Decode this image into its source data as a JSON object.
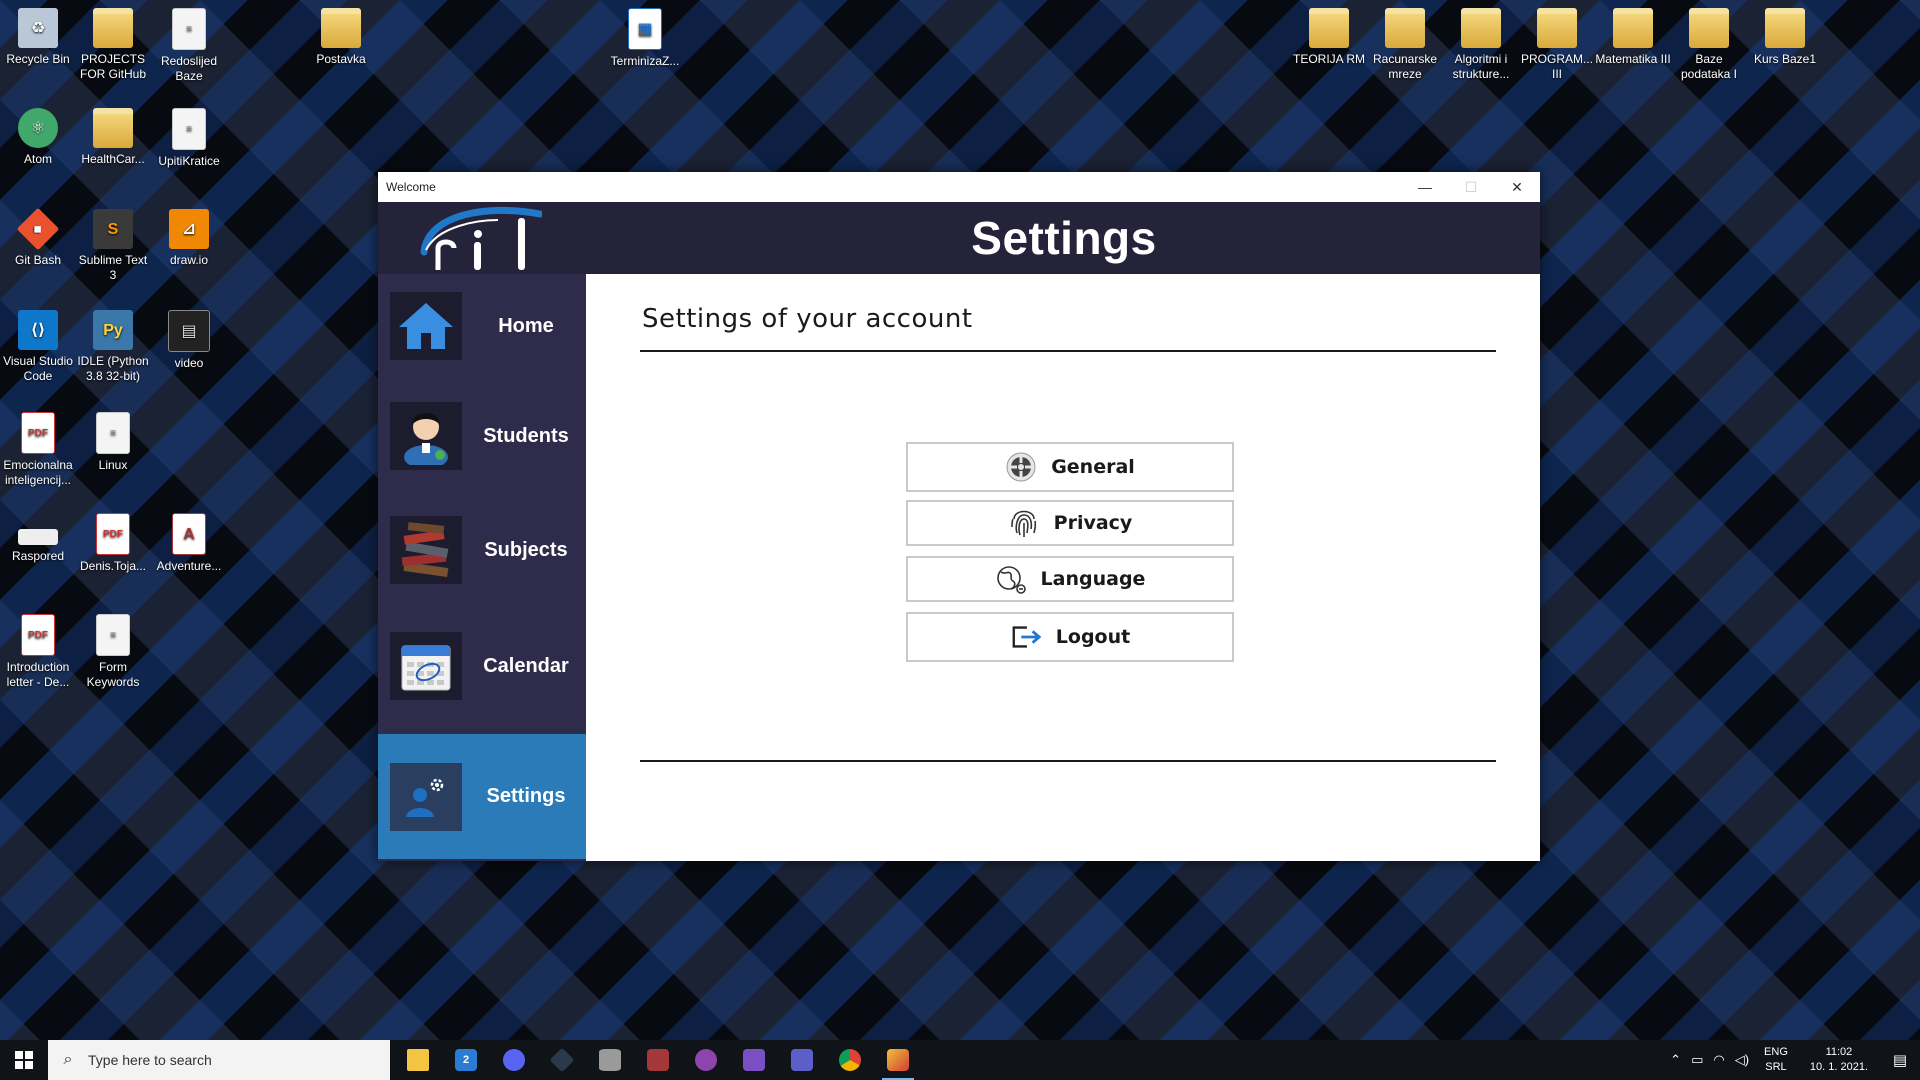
{
  "desktop": {
    "icons": [
      {
        "label": "Recycle Bin",
        "glyph": "♻"
      },
      {
        "label": "PROJECTS FOR GitHub",
        "glyph": ""
      },
      {
        "label": "Redoslijed Baze",
        "glyph": "≡"
      },
      {
        "label": "Postavka",
        "glyph": ""
      },
      {
        "label": "TerminizaZ...",
        "glyph": "▦"
      },
      {
        "label": "TEORIJA RM",
        "glyph": ""
      },
      {
        "label": "Racunarske mreze",
        "glyph": ""
      },
      {
        "label": "Algoritmi i strukture...",
        "glyph": ""
      },
      {
        "label": "PROGRAM... III",
        "glyph": ""
      },
      {
        "label": "Matematika III",
        "glyph": ""
      },
      {
        "label": "Baze podataka I",
        "glyph": ""
      },
      {
        "label": "Kurs Baze1",
        "glyph": ""
      },
      {
        "label": "Atom",
        "glyph": "⚛"
      },
      {
        "label": "HealthCar...",
        "glyph": ""
      },
      {
        "label": "UpitiKratice",
        "glyph": "≡"
      },
      {
        "label": "Git Bash",
        "glyph": "◆"
      },
      {
        "label": "Sublime Text 3",
        "glyph": "S"
      },
      {
        "label": "draw.io",
        "glyph": "⊿"
      },
      {
        "label": "Visual Studio Code",
        "glyph": "⟨⟩"
      },
      {
        "label": "IDLE (Python 3.8 32-bit)",
        "glyph": "Py"
      },
      {
        "label": "video",
        "glyph": "▤"
      },
      {
        "label": "Emocionalna inteligencij...",
        "glyph": "PDF"
      },
      {
        "label": "Linux",
        "glyph": "≡"
      },
      {
        "label": "Raspored",
        "glyph": ""
      },
      {
        "label": "Denis.Toja...",
        "glyph": "PDF"
      },
      {
        "label": "Adventure...",
        "glyph": "A"
      },
      {
        "label": "Introduction letter - De...",
        "glyph": "PDF"
      },
      {
        "label": "Form Keywords",
        "glyph": "≡"
      }
    ]
  },
  "window": {
    "title": "Welcome",
    "controls": {
      "minimize": "—",
      "maximize": "☐",
      "close": "✕"
    }
  },
  "header": {
    "page_title": "Settings"
  },
  "sidebar": {
    "items": [
      {
        "label": "Home",
        "icon": "home-icon"
      },
      {
        "label": "Students",
        "icon": "student-icon"
      },
      {
        "label": "Subjects",
        "icon": "books-icon"
      },
      {
        "label": "Calendar",
        "icon": "calendar-icon"
      },
      {
        "label": "Settings",
        "icon": "user-settings-icon",
        "active": true
      }
    ]
  },
  "main": {
    "heading": "Settings of your account",
    "options": [
      {
        "label": "General",
        "icon": "gear-icon"
      },
      {
        "label": "Privacy",
        "icon": "fingerprint-icon"
      },
      {
        "label": "Language",
        "icon": "language-icon"
      },
      {
        "label": "Logout",
        "icon": "logout-icon"
      }
    ]
  },
  "taskbar": {
    "search_placeholder": "Type here to search",
    "apps": [
      "file-explorer",
      "mail",
      "discord",
      "sourcetree",
      "database",
      "access",
      "app",
      "visual-studio",
      "teams",
      "chrome",
      "winforms-app"
    ],
    "mail_badge": "2",
    "language": "ENG",
    "keyboard": "SRL",
    "time": "11:02",
    "date": "10. 1. 2021."
  },
  "colors": {
    "header_bg": "#24233a",
    "sidebar_bg": "#2e2c4a",
    "active_nav": "#2b7bb9"
  }
}
